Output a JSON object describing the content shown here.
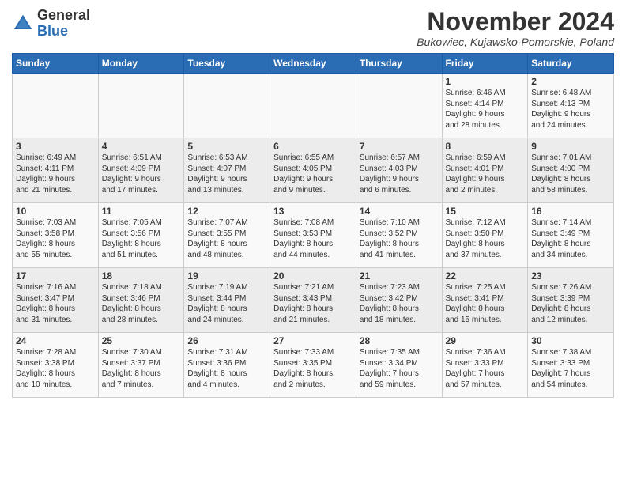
{
  "header": {
    "logo_general": "General",
    "logo_blue": "Blue",
    "month_title": "November 2024",
    "location": "Bukowiec, Kujawsko-Pomorskie, Poland"
  },
  "days_of_week": [
    "Sunday",
    "Monday",
    "Tuesday",
    "Wednesday",
    "Thursday",
    "Friday",
    "Saturday"
  ],
  "weeks": [
    [
      {
        "day": "",
        "info": ""
      },
      {
        "day": "",
        "info": ""
      },
      {
        "day": "",
        "info": ""
      },
      {
        "day": "",
        "info": ""
      },
      {
        "day": "",
        "info": ""
      },
      {
        "day": "1",
        "info": "Sunrise: 6:46 AM\nSunset: 4:14 PM\nDaylight: 9 hours\nand 28 minutes."
      },
      {
        "day": "2",
        "info": "Sunrise: 6:48 AM\nSunset: 4:13 PM\nDaylight: 9 hours\nand 24 minutes."
      }
    ],
    [
      {
        "day": "3",
        "info": "Sunrise: 6:49 AM\nSunset: 4:11 PM\nDaylight: 9 hours\nand 21 minutes."
      },
      {
        "day": "4",
        "info": "Sunrise: 6:51 AM\nSunset: 4:09 PM\nDaylight: 9 hours\nand 17 minutes."
      },
      {
        "day": "5",
        "info": "Sunrise: 6:53 AM\nSunset: 4:07 PM\nDaylight: 9 hours\nand 13 minutes."
      },
      {
        "day": "6",
        "info": "Sunrise: 6:55 AM\nSunset: 4:05 PM\nDaylight: 9 hours\nand 9 minutes."
      },
      {
        "day": "7",
        "info": "Sunrise: 6:57 AM\nSunset: 4:03 PM\nDaylight: 9 hours\nand 6 minutes."
      },
      {
        "day": "8",
        "info": "Sunrise: 6:59 AM\nSunset: 4:01 PM\nDaylight: 9 hours\nand 2 minutes."
      },
      {
        "day": "9",
        "info": "Sunrise: 7:01 AM\nSunset: 4:00 PM\nDaylight: 8 hours\nand 58 minutes."
      }
    ],
    [
      {
        "day": "10",
        "info": "Sunrise: 7:03 AM\nSunset: 3:58 PM\nDaylight: 8 hours\nand 55 minutes."
      },
      {
        "day": "11",
        "info": "Sunrise: 7:05 AM\nSunset: 3:56 PM\nDaylight: 8 hours\nand 51 minutes."
      },
      {
        "day": "12",
        "info": "Sunrise: 7:07 AM\nSunset: 3:55 PM\nDaylight: 8 hours\nand 48 minutes."
      },
      {
        "day": "13",
        "info": "Sunrise: 7:08 AM\nSunset: 3:53 PM\nDaylight: 8 hours\nand 44 minutes."
      },
      {
        "day": "14",
        "info": "Sunrise: 7:10 AM\nSunset: 3:52 PM\nDaylight: 8 hours\nand 41 minutes."
      },
      {
        "day": "15",
        "info": "Sunrise: 7:12 AM\nSunset: 3:50 PM\nDaylight: 8 hours\nand 37 minutes."
      },
      {
        "day": "16",
        "info": "Sunrise: 7:14 AM\nSunset: 3:49 PM\nDaylight: 8 hours\nand 34 minutes."
      }
    ],
    [
      {
        "day": "17",
        "info": "Sunrise: 7:16 AM\nSunset: 3:47 PM\nDaylight: 8 hours\nand 31 minutes."
      },
      {
        "day": "18",
        "info": "Sunrise: 7:18 AM\nSunset: 3:46 PM\nDaylight: 8 hours\nand 28 minutes."
      },
      {
        "day": "19",
        "info": "Sunrise: 7:19 AM\nSunset: 3:44 PM\nDaylight: 8 hours\nand 24 minutes."
      },
      {
        "day": "20",
        "info": "Sunrise: 7:21 AM\nSunset: 3:43 PM\nDaylight: 8 hours\nand 21 minutes."
      },
      {
        "day": "21",
        "info": "Sunrise: 7:23 AM\nSunset: 3:42 PM\nDaylight: 8 hours\nand 18 minutes."
      },
      {
        "day": "22",
        "info": "Sunrise: 7:25 AM\nSunset: 3:41 PM\nDaylight: 8 hours\nand 15 minutes."
      },
      {
        "day": "23",
        "info": "Sunrise: 7:26 AM\nSunset: 3:39 PM\nDaylight: 8 hours\nand 12 minutes."
      }
    ],
    [
      {
        "day": "24",
        "info": "Sunrise: 7:28 AM\nSunset: 3:38 PM\nDaylight: 8 hours\nand 10 minutes."
      },
      {
        "day": "25",
        "info": "Sunrise: 7:30 AM\nSunset: 3:37 PM\nDaylight: 8 hours\nand 7 minutes."
      },
      {
        "day": "26",
        "info": "Sunrise: 7:31 AM\nSunset: 3:36 PM\nDaylight: 8 hours\nand 4 minutes."
      },
      {
        "day": "27",
        "info": "Sunrise: 7:33 AM\nSunset: 3:35 PM\nDaylight: 8 hours\nand 2 minutes."
      },
      {
        "day": "28",
        "info": "Sunrise: 7:35 AM\nSunset: 3:34 PM\nDaylight: 7 hours\nand 59 minutes."
      },
      {
        "day": "29",
        "info": "Sunrise: 7:36 AM\nSunset: 3:33 PM\nDaylight: 7 hours\nand 57 minutes."
      },
      {
        "day": "30",
        "info": "Sunrise: 7:38 AM\nSunset: 3:33 PM\nDaylight: 7 hours\nand 54 minutes."
      }
    ]
  ]
}
